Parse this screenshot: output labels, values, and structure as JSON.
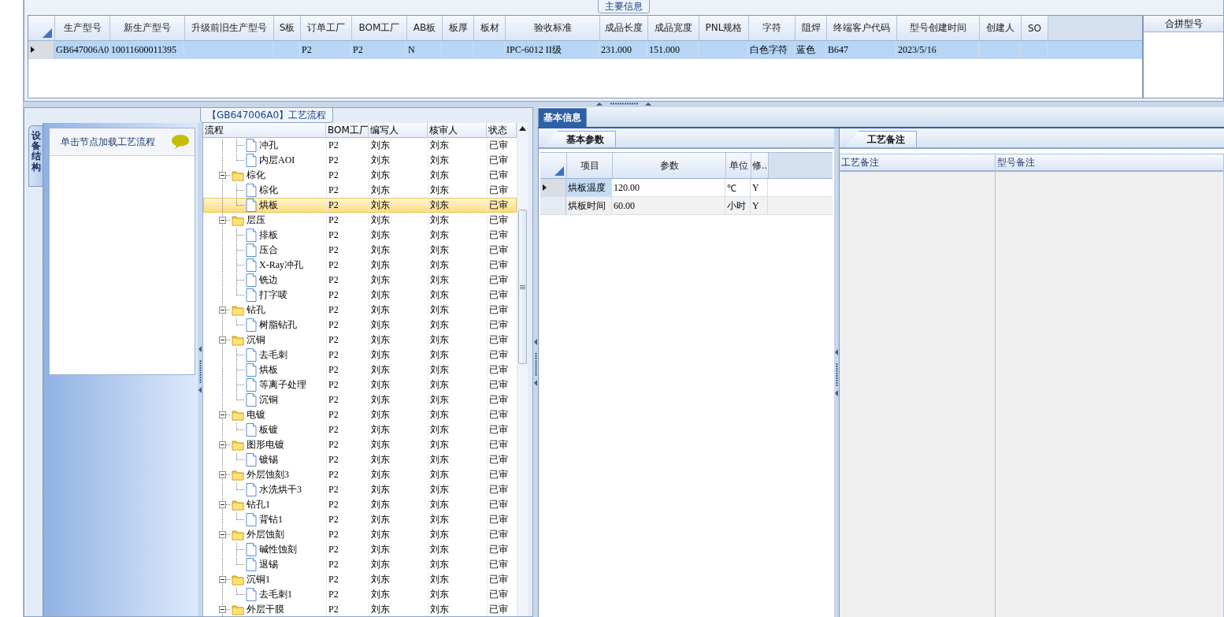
{
  "main_info": {
    "title": "主要信息",
    "columns": [
      "生产型号",
      "新生产型号",
      "升级前旧生产型号",
      "S板",
      "订单工厂",
      "BOM工厂",
      "AB板",
      "板厚",
      "板材",
      "验收标准",
      "成品长度",
      "成品宽度",
      "PNL规格",
      "字符",
      "阻焊",
      "终端客户代码",
      "型号创建时间",
      "创建人",
      "SO"
    ],
    "rows": [
      {
        "selected": true,
        "cells": [
          "GB647006A0",
          "10011600011395",
          null,
          null,
          "P2",
          "P2",
          "N",
          null,
          null,
          "IPC-6012 II级",
          "231.000",
          "151.000",
          null,
          "白色字符",
          "蓝色",
          "B647",
          "2023/5/16",
          null,
          null
        ]
      }
    ]
  },
  "merge_panel": {
    "header": "合拼型号"
  },
  "process": {
    "title": "【GB647006A0】工艺流程",
    "side_tab": {
      "label": "设备结构",
      "selected": true
    },
    "hint": "单击节点加载工艺流程",
    "columns": [
      "流程",
      "BOM工厂",
      "编写人",
      "核审人",
      "状态"
    ],
    "items": [
      {
        "kind": "continuation",
        "children": [
          {
            "kind": "file",
            "label": "冲孔",
            "bom": "P2",
            "writer": "刘东",
            "reviewer": "刘东",
            "status": "已审",
            "selected": false
          },
          {
            "kind": "file",
            "label": "内层AOI",
            "bom": "P2",
            "writer": "刘东",
            "reviewer": "刘东",
            "status": "已审",
            "selected": false
          }
        ]
      },
      {
        "kind": "folder",
        "label": "棕化",
        "bom": "P2",
        "writer": "刘东",
        "reviewer": "刘东",
        "status": "已审",
        "selected": false,
        "expanded": true,
        "children": [
          {
            "kind": "file",
            "label": "棕化",
            "bom": "P2",
            "writer": "刘东",
            "reviewer": "刘东",
            "status": "已审",
            "selected": false
          },
          {
            "kind": "file",
            "label": "烘板",
            "bom": "P2",
            "writer": "刘东",
            "reviewer": "刘东",
            "status": "已审",
            "selected": true
          }
        ]
      },
      {
        "kind": "folder",
        "label": "层压",
        "bom": "P2",
        "writer": "刘东",
        "reviewer": "刘东",
        "status": "已审",
        "selected": false,
        "expanded": true,
        "children": [
          {
            "kind": "file",
            "label": "排板",
            "bom": "P2",
            "writer": "刘东",
            "reviewer": "刘东",
            "status": "已审",
            "selected": false
          },
          {
            "kind": "file",
            "label": "压合",
            "bom": "P2",
            "writer": "刘东",
            "reviewer": "刘东",
            "status": "已审",
            "selected": false
          },
          {
            "kind": "file",
            "label": "X-Ray冲孔",
            "bom": "P2",
            "writer": "刘东",
            "reviewer": "刘东",
            "status": "已审",
            "selected": false
          },
          {
            "kind": "file",
            "label": "铣边",
            "bom": "P2",
            "writer": "刘东",
            "reviewer": "刘东",
            "status": "已审",
            "selected": false
          },
          {
            "kind": "file",
            "label": "打字唛",
            "bom": "P2",
            "writer": "刘东",
            "reviewer": "刘东",
            "status": "已审",
            "selected": false
          }
        ]
      },
      {
        "kind": "folder",
        "label": "钻孔",
        "bom": "P2",
        "writer": "刘东",
        "reviewer": "刘东",
        "status": "已审",
        "selected": false,
        "expanded": true,
        "children": [
          {
            "kind": "file",
            "label": "树脂钻孔",
            "bom": "P2",
            "writer": "刘东",
            "reviewer": "刘东",
            "status": "已审",
            "selected": false
          }
        ]
      },
      {
        "kind": "folder",
        "label": "沉铜",
        "bom": "P2",
        "writer": "刘东",
        "reviewer": "刘东",
        "status": "已审",
        "selected": false,
        "expanded": true,
        "children": [
          {
            "kind": "file",
            "label": "去毛刺",
            "bom": "P2",
            "writer": "刘东",
            "reviewer": "刘东",
            "status": "已审",
            "selected": false
          },
          {
            "kind": "file",
            "label": "烘板",
            "bom": "P2",
            "writer": "刘东",
            "reviewer": "刘东",
            "status": "已审",
            "selected": false
          },
          {
            "kind": "file",
            "label": "等离子处理",
            "bom": "P2",
            "writer": "刘东",
            "reviewer": "刘东",
            "status": "已审",
            "selected": false
          },
          {
            "kind": "file",
            "label": "沉铜",
            "bom": "P2",
            "writer": "刘东",
            "reviewer": "刘东",
            "status": "已审",
            "selected": false
          }
        ]
      },
      {
        "kind": "folder",
        "label": "电镀",
        "bom": "P2",
        "writer": "刘东",
        "reviewer": "刘东",
        "status": "已审",
        "selected": false,
        "expanded": true,
        "children": [
          {
            "kind": "file",
            "label": "板镀",
            "bom": "P2",
            "writer": "刘东",
            "reviewer": "刘东",
            "status": "已审",
            "selected": false
          }
        ]
      },
      {
        "kind": "folder",
        "label": "图形电镀",
        "bom": "P2",
        "writer": "刘东",
        "reviewer": "刘东",
        "status": "已审",
        "selected": false,
        "expanded": true,
        "children": [
          {
            "kind": "file",
            "label": "镀锡",
            "bom": "P2",
            "writer": "刘东",
            "reviewer": "刘东",
            "status": "已审",
            "selected": false
          }
        ]
      },
      {
        "kind": "folder",
        "label": "外层蚀刻3",
        "bom": "P2",
        "writer": "刘东",
        "reviewer": "刘东",
        "status": "已审",
        "selected": false,
        "expanded": true,
        "children": [
          {
            "kind": "file",
            "label": "水洗烘干3",
            "bom": "P2",
            "writer": "刘东",
            "reviewer": "刘东",
            "status": "已审",
            "selected": false
          }
        ]
      },
      {
        "kind": "folder",
        "label": "钻孔1",
        "bom": "P2",
        "writer": "刘东",
        "reviewer": "刘东",
        "status": "已审",
        "selected": false,
        "expanded": true,
        "children": [
          {
            "kind": "file",
            "label": "背钻1",
            "bom": "P2",
            "writer": "刘东",
            "reviewer": "刘东",
            "status": "已审",
            "selected": false
          }
        ]
      },
      {
        "kind": "folder",
        "label": "外层蚀刻",
        "bom": "P2",
        "writer": "刘东",
        "reviewer": "刘东",
        "status": "已审",
        "selected": false,
        "expanded": true,
        "children": [
          {
            "kind": "file",
            "label": "碱性蚀刻",
            "bom": "P2",
            "writer": "刘东",
            "reviewer": "刘东",
            "status": "已审",
            "selected": false
          },
          {
            "kind": "file",
            "label": "退锡",
            "bom": "P2",
            "writer": "刘东",
            "reviewer": "刘东",
            "status": "已审",
            "selected": false
          }
        ]
      },
      {
        "kind": "folder",
        "label": "沉铜1",
        "bom": "P2",
        "writer": "刘东",
        "reviewer": "刘东",
        "status": "已审",
        "selected": false,
        "expanded": true,
        "children": [
          {
            "kind": "file",
            "label": "去毛刺1",
            "bom": "P2",
            "writer": "刘东",
            "reviewer": "刘东",
            "status": "已审",
            "selected": false
          }
        ]
      },
      {
        "kind": "folder",
        "label": "外层干膜",
        "bom": "P2",
        "writer": "刘东",
        "reviewer": "刘东",
        "status": "已审",
        "selected": false,
        "expanded": true
      }
    ]
  },
  "detail": {
    "tab": {
      "label": "基本信息",
      "selected": true
    },
    "params": {
      "tab": {
        "label": "基本参数",
        "selected": true
      },
      "columns": [
        "项目",
        "参数",
        "单位",
        "修.."
      ],
      "rows": [
        {
          "selected": true,
          "cells": [
            "烘板温度",
            "120.00",
            "℃",
            "Y"
          ]
        },
        {
          "selected": false,
          "cells": [
            "烘板时间",
            "60.00",
            "小时",
            "Y"
          ]
        }
      ]
    },
    "remarks": {
      "tab": {
        "label": "工艺备注",
        "selected": true
      },
      "columns": [
        "工艺备注",
        "型号备注"
      ]
    }
  }
}
